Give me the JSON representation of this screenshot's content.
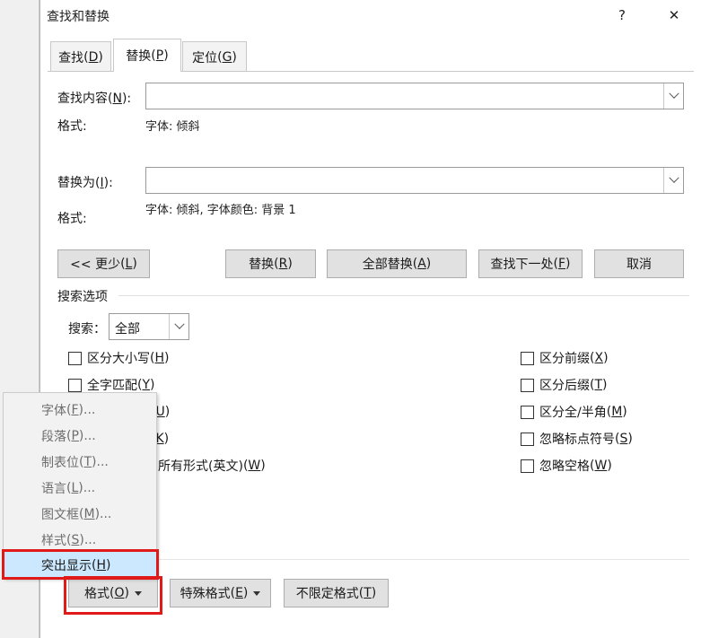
{
  "window": {
    "title": "查找和替换",
    "help_glyph": "?",
    "close_glyph": "✕"
  },
  "tabs": [
    {
      "label": "查找",
      "key": "D"
    },
    {
      "label": "替换",
      "key": "P"
    },
    {
      "label": "定位",
      "key": "G"
    }
  ],
  "find": {
    "label": "查找内容",
    "key": "N",
    "value": "",
    "format_label": "格式:",
    "format_value": "字体: 倾斜"
  },
  "replace": {
    "label": "替换为",
    "key": "I",
    "value": "",
    "format_label": "格式:",
    "format_value": "字体: 倾斜, 字体颜色: 背景 1"
  },
  "buttons": {
    "less": {
      "label": "<< 更少",
      "key": "L"
    },
    "replace": {
      "label": "替换",
      "key": "R"
    },
    "replace_all": {
      "label": "全部替换",
      "key": "A"
    },
    "find_next": {
      "label": "查找下一处",
      "key": "F"
    },
    "cancel": {
      "label": "取消"
    }
  },
  "search_options": {
    "title": "搜索选项",
    "search_label": "搜索",
    "search_key": "：",
    "search_value": "全部",
    "left_options": [
      {
        "label": "区分大小写",
        "key": "H",
        "checked": false
      },
      {
        "label": "全字匹配",
        "key": "Y",
        "checked": false
      },
      {
        "prefix": "",
        "key": "U",
        "checked": false
      },
      {
        "prefix": "",
        "key": "K",
        "checked": false
      },
      {
        "label": "所有形式(英文)",
        "key": "W",
        "checked": false
      }
    ],
    "right_options": [
      {
        "label": "区分前缀",
        "key": "X",
        "checked": false
      },
      {
        "label": "区分后缀",
        "key": "T",
        "checked": false
      },
      {
        "label": "区分全/半角",
        "key": "M",
        "checked": false
      },
      {
        "label": "忽略标点符号",
        "key": "S",
        "checked": false
      },
      {
        "label": "忽略空格",
        "key": "W",
        "checked": false
      }
    ]
  },
  "bottom_buttons": {
    "format": {
      "label": "格式",
      "key": "O"
    },
    "special": {
      "label": "特殊格式",
      "key": "E"
    },
    "no_format": {
      "label": "不限定格式",
      "key": "T"
    }
  },
  "format_menu": [
    {
      "label": "字体",
      "key": "F",
      "suffix": "..."
    },
    {
      "label": "段落",
      "key": "P",
      "suffix": "..."
    },
    {
      "label": "制表位",
      "key": "T",
      "suffix": "..."
    },
    {
      "label": "语言",
      "key": "L",
      "suffix": "..."
    },
    {
      "label": "图文框",
      "key": "M",
      "suffix": "..."
    },
    {
      "label": "样式",
      "key": "S",
      "suffix": "..."
    },
    {
      "label": "突出显示",
      "key": "H",
      "suffix": "",
      "highlighted": true
    }
  ],
  "colors": {
    "highlight_red": "#e01919",
    "menu_hover": "#cce8ff"
  }
}
